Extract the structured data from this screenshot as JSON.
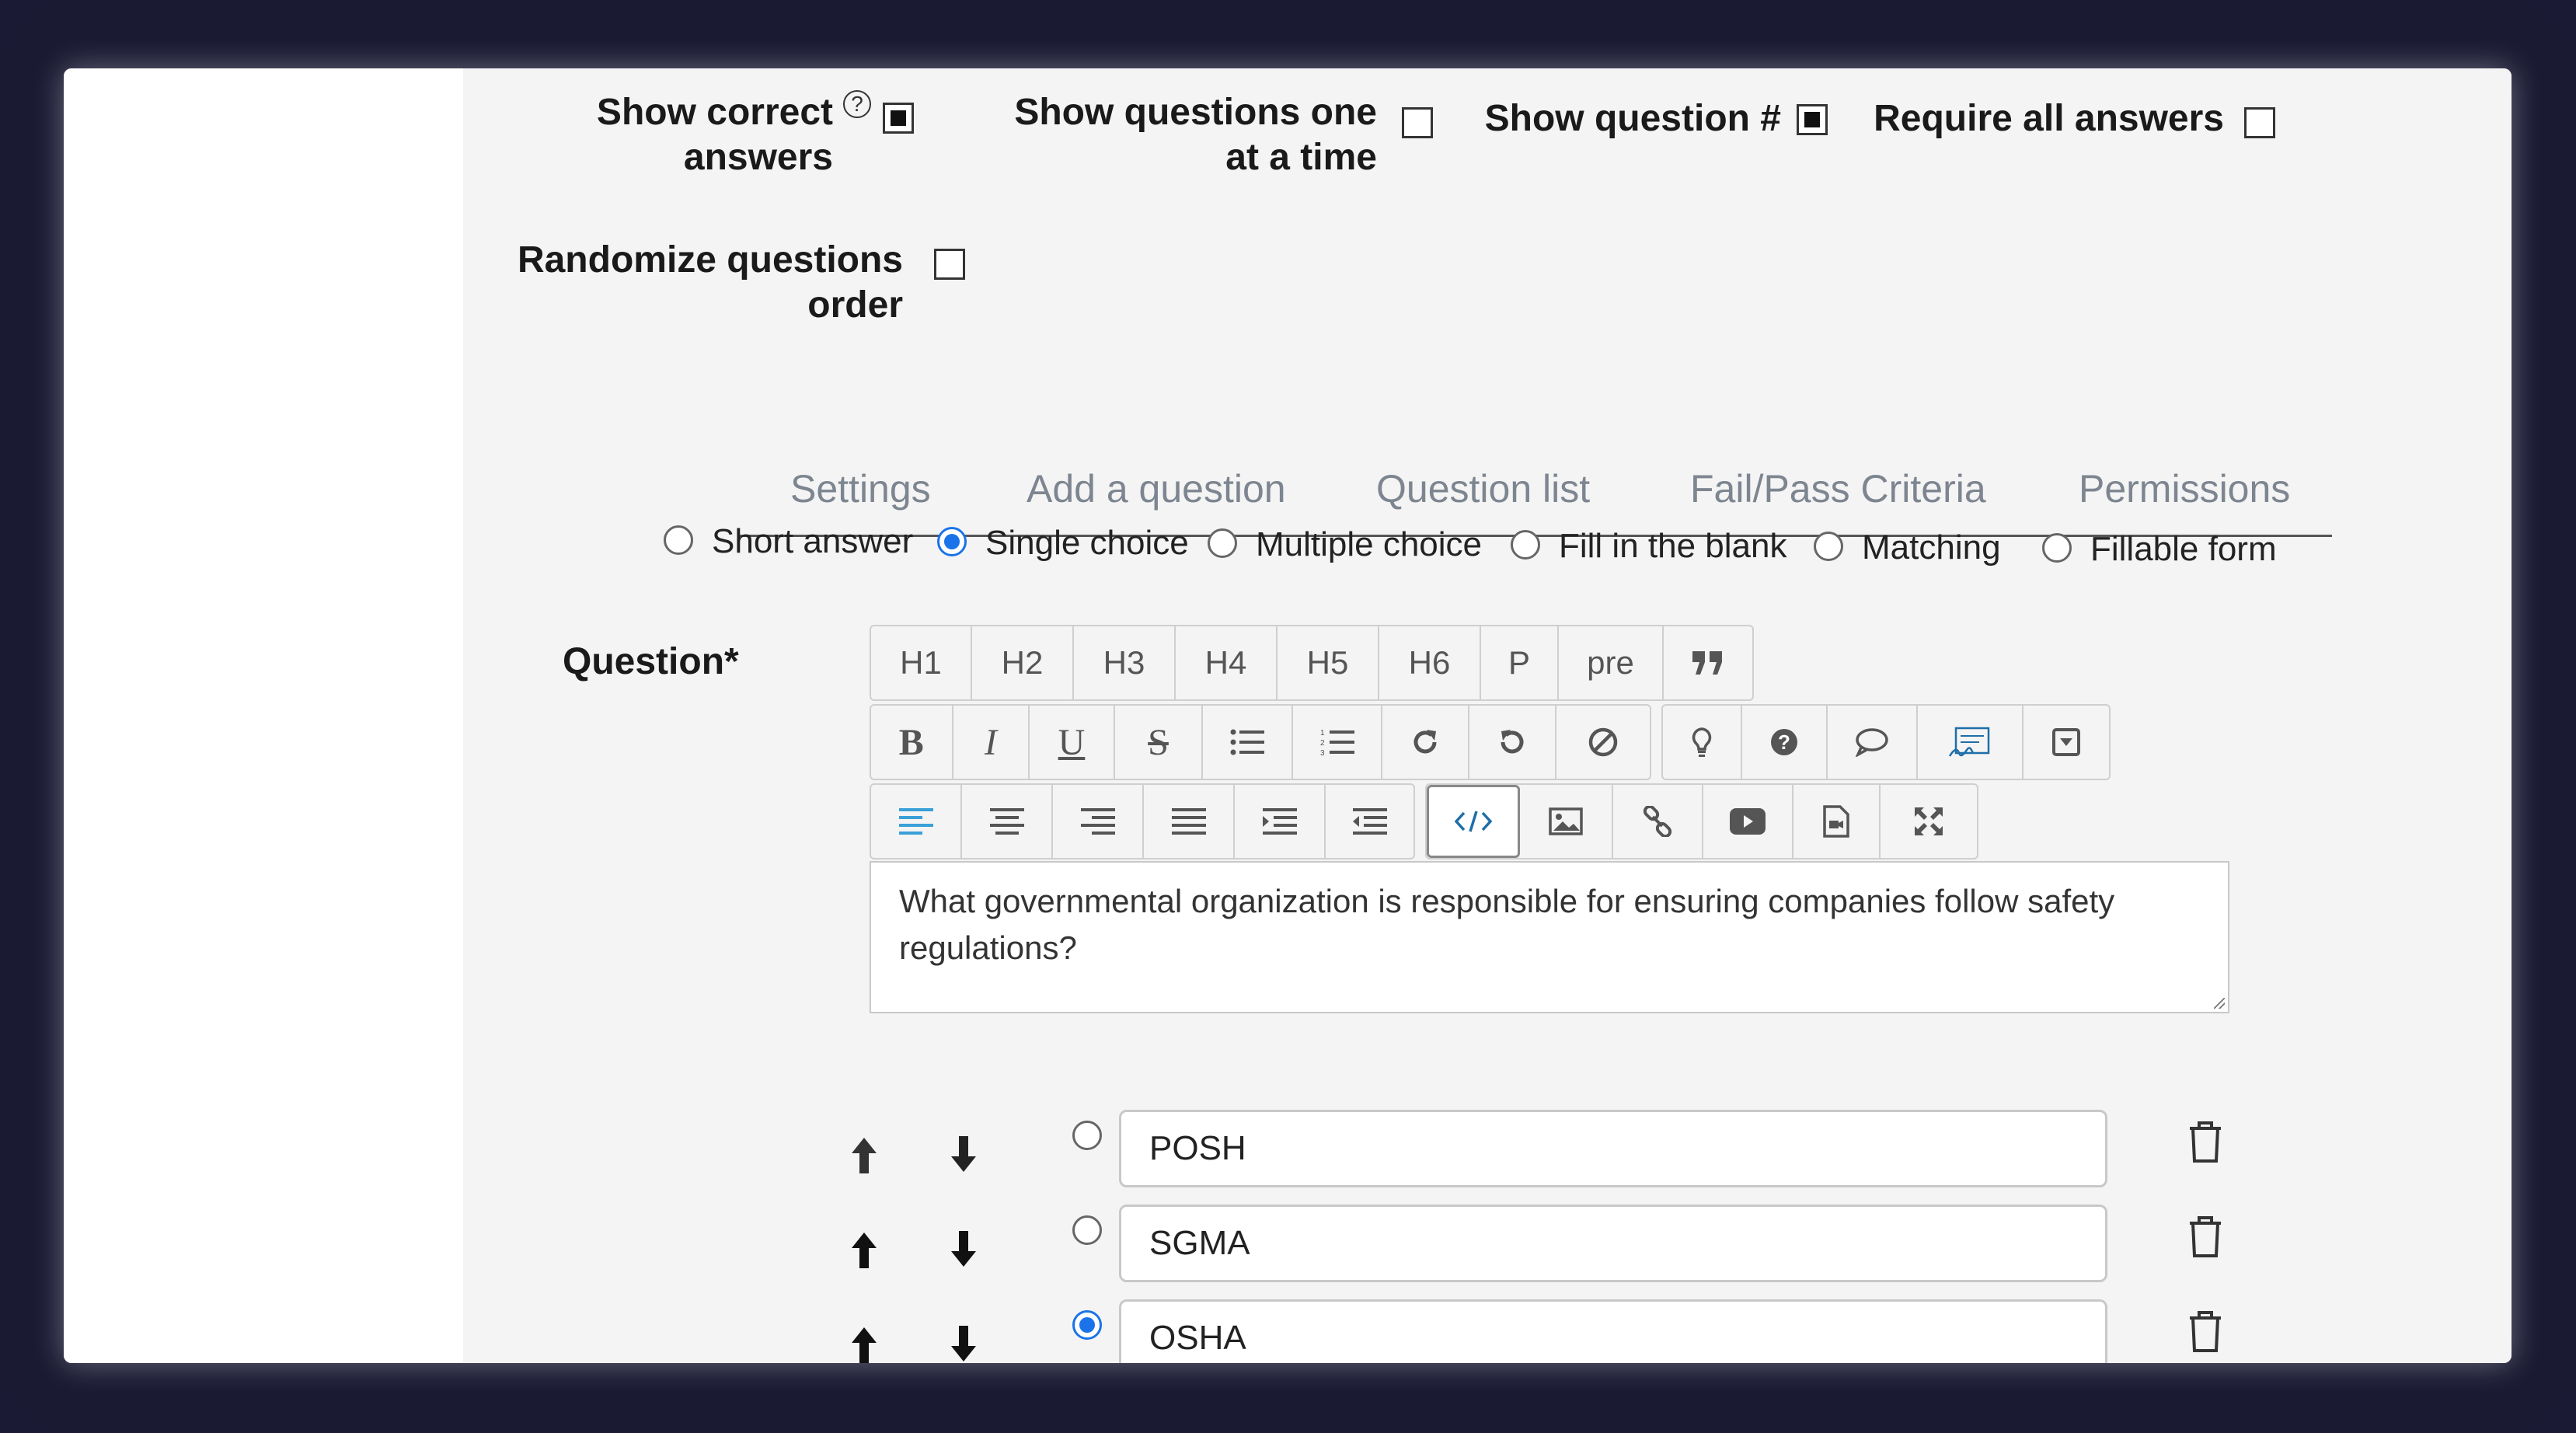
{
  "settings": {
    "show_correct_answers": {
      "label_line1": "Show correct",
      "label_line2": "answers",
      "help": "?",
      "checked": true
    },
    "show_one_at_a_time": {
      "label_line1": "Show questions one",
      "label_line2": "at a time",
      "checked": false
    },
    "show_question_number": {
      "label": "Show question #",
      "checked": true
    },
    "require_all_answers": {
      "label": "Require all answers",
      "checked": false
    },
    "randomize_order": {
      "label_line1": "Randomize questions",
      "label_line2": "order",
      "checked": false
    }
  },
  "tabs": [
    "Settings",
    "Add a question",
    "Question list",
    "Fail/Pass Criteria",
    "Permissions"
  ],
  "question_types": {
    "options": [
      "Short answer",
      "Single choice",
      "Multiple choice",
      "Fill in the blank",
      "Matching",
      "Fillable form"
    ],
    "selected": "Single choice"
  },
  "question": {
    "label": "Question*",
    "text": "What governmental organization is responsible for ensuring companies follow safety regulations?"
  },
  "toolbar": {
    "headings": [
      "H1",
      "H2",
      "H3",
      "H4",
      "H5",
      "H6",
      "P",
      "pre"
    ],
    "format_icons": [
      "bold-icon",
      "italic-icon",
      "underline-icon",
      "strikethrough-icon",
      "bullet-list-icon",
      "numbered-list-icon",
      "redo-icon",
      "undo-icon",
      "clear-format-icon"
    ],
    "extra_icons": [
      "lightbulb-icon",
      "question-circle-icon",
      "comment-icon",
      "signature-icon",
      "dropdown-field-icon"
    ],
    "align_icons": [
      "align-left-icon",
      "align-center-icon",
      "align-right-icon",
      "align-justify-icon",
      "indent-icon",
      "outdent-icon"
    ],
    "insert_icons": [
      "code-view-icon",
      "image-icon",
      "link-icon",
      "video-icon",
      "file-icon"
    ],
    "fullscreen_icon": "fullscreen-icon",
    "active_color": "#3aa0d8"
  },
  "answers": [
    {
      "text": "POSH",
      "selected": false
    },
    {
      "text": "SGMA",
      "selected": false
    },
    {
      "text": "OSHA",
      "selected": true
    }
  ],
  "colors": {
    "accent": "#1a73e8",
    "background": "#f4f4f4",
    "tab_text": "#7d8590"
  }
}
